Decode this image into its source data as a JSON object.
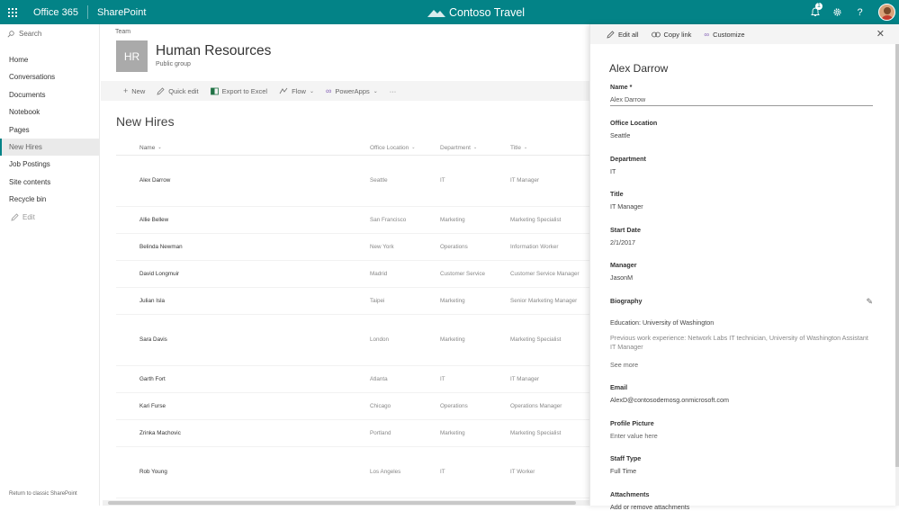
{
  "suite_bar": {
    "app_name": "Office 365",
    "product": "SharePoint",
    "brand": "Contoso Travel",
    "notification_count": "1",
    "accent_color": "#038387"
  },
  "left_nav": {
    "search_placeholder": "Search",
    "items": [
      {
        "label": "Home"
      },
      {
        "label": "Conversations"
      },
      {
        "label": "Documents"
      },
      {
        "label": "Notebook"
      },
      {
        "label": "Pages"
      },
      {
        "label": "New Hires"
      },
      {
        "label": "Job Postings"
      },
      {
        "label": "Site contents"
      },
      {
        "label": "Recycle bin"
      }
    ],
    "selected_item": "New Hires",
    "edit_label": "Edit",
    "return_label": "Return to classic SharePoint"
  },
  "site": {
    "team_label": "Team",
    "logo_text": "HR",
    "title": "Human Resources",
    "subtitle": "Public group"
  },
  "command_bar": {
    "new": "New",
    "quick_edit": "Quick edit",
    "export": "Export to Excel",
    "flow": "Flow",
    "powerapps": "PowerApps",
    "more": "···"
  },
  "list": {
    "title": "New Hires",
    "columns": {
      "name": "Name",
      "office": "Office Location",
      "department": "Department",
      "title": "Title"
    },
    "rows": [
      {
        "name": "Alex Darrow",
        "office": "Seattle",
        "department": "IT",
        "title": "IT Manager"
      },
      {
        "name": "Allie Bellew",
        "office": "San Francisco",
        "department": "Marketing",
        "title": "Marketing Specialist"
      },
      {
        "name": "Belinda Newman",
        "office": "New York",
        "department": "Operations",
        "title": "Information Worker"
      },
      {
        "name": "David Longmuir",
        "office": "Madrid",
        "department": "Customer Service",
        "title": "Customer Service Manager"
      },
      {
        "name": "Julian Isla",
        "office": "Taipei",
        "department": "Marketing",
        "title": "Senior Marketing Manager"
      },
      {
        "name": "Sara Davis",
        "office": "London",
        "department": "Marketing",
        "title": "Marketing Specialist"
      },
      {
        "name": "Garth Fort",
        "office": "Atlanta",
        "department": "IT",
        "title": "IT Manager"
      },
      {
        "name": "Kari Furse",
        "office": "Chicago",
        "department": "Operations",
        "title": "Operations Manager"
      },
      {
        "name": "Zrinka Machovic",
        "office": "Portland",
        "department": "Marketing",
        "title": "Marketing Specialist"
      },
      {
        "name": "Rob Young",
        "office": "Los Angeles",
        "department": "IT",
        "title": "IT Worker"
      }
    ]
  },
  "panel": {
    "edit_all": "Edit all",
    "copy_link": "Copy link",
    "customize": "Customize",
    "heading": "Alex Darrow",
    "name_label": "Name *",
    "name_value": "Alex Darrow",
    "office_label": "Office Location",
    "office_value": "Seattle",
    "department_label": "Department",
    "department_value": "IT",
    "title_label": "Title",
    "title_value": "IT Manager",
    "start_label": "Start Date",
    "start_value": "2/1/2017",
    "manager_label": "Manager",
    "manager_value": "JasonM",
    "bio_label": "Biography",
    "bio_line1": "Education: University of Washington",
    "bio_line2": "Previous work experience: Network Labs IT technician, University of Washington Assistant IT Manager",
    "see_more": "See more",
    "email_label": "Email",
    "email_value": "AlexD@contosodemosg.onmicrosoft.com",
    "picture_label": "Profile Picture",
    "picture_placeholder": "Enter value here",
    "staff_label": "Staff Type",
    "staff_value": "Full Time",
    "attachments_label": "Attachments",
    "attachments_link": "Add or remove attachments"
  }
}
